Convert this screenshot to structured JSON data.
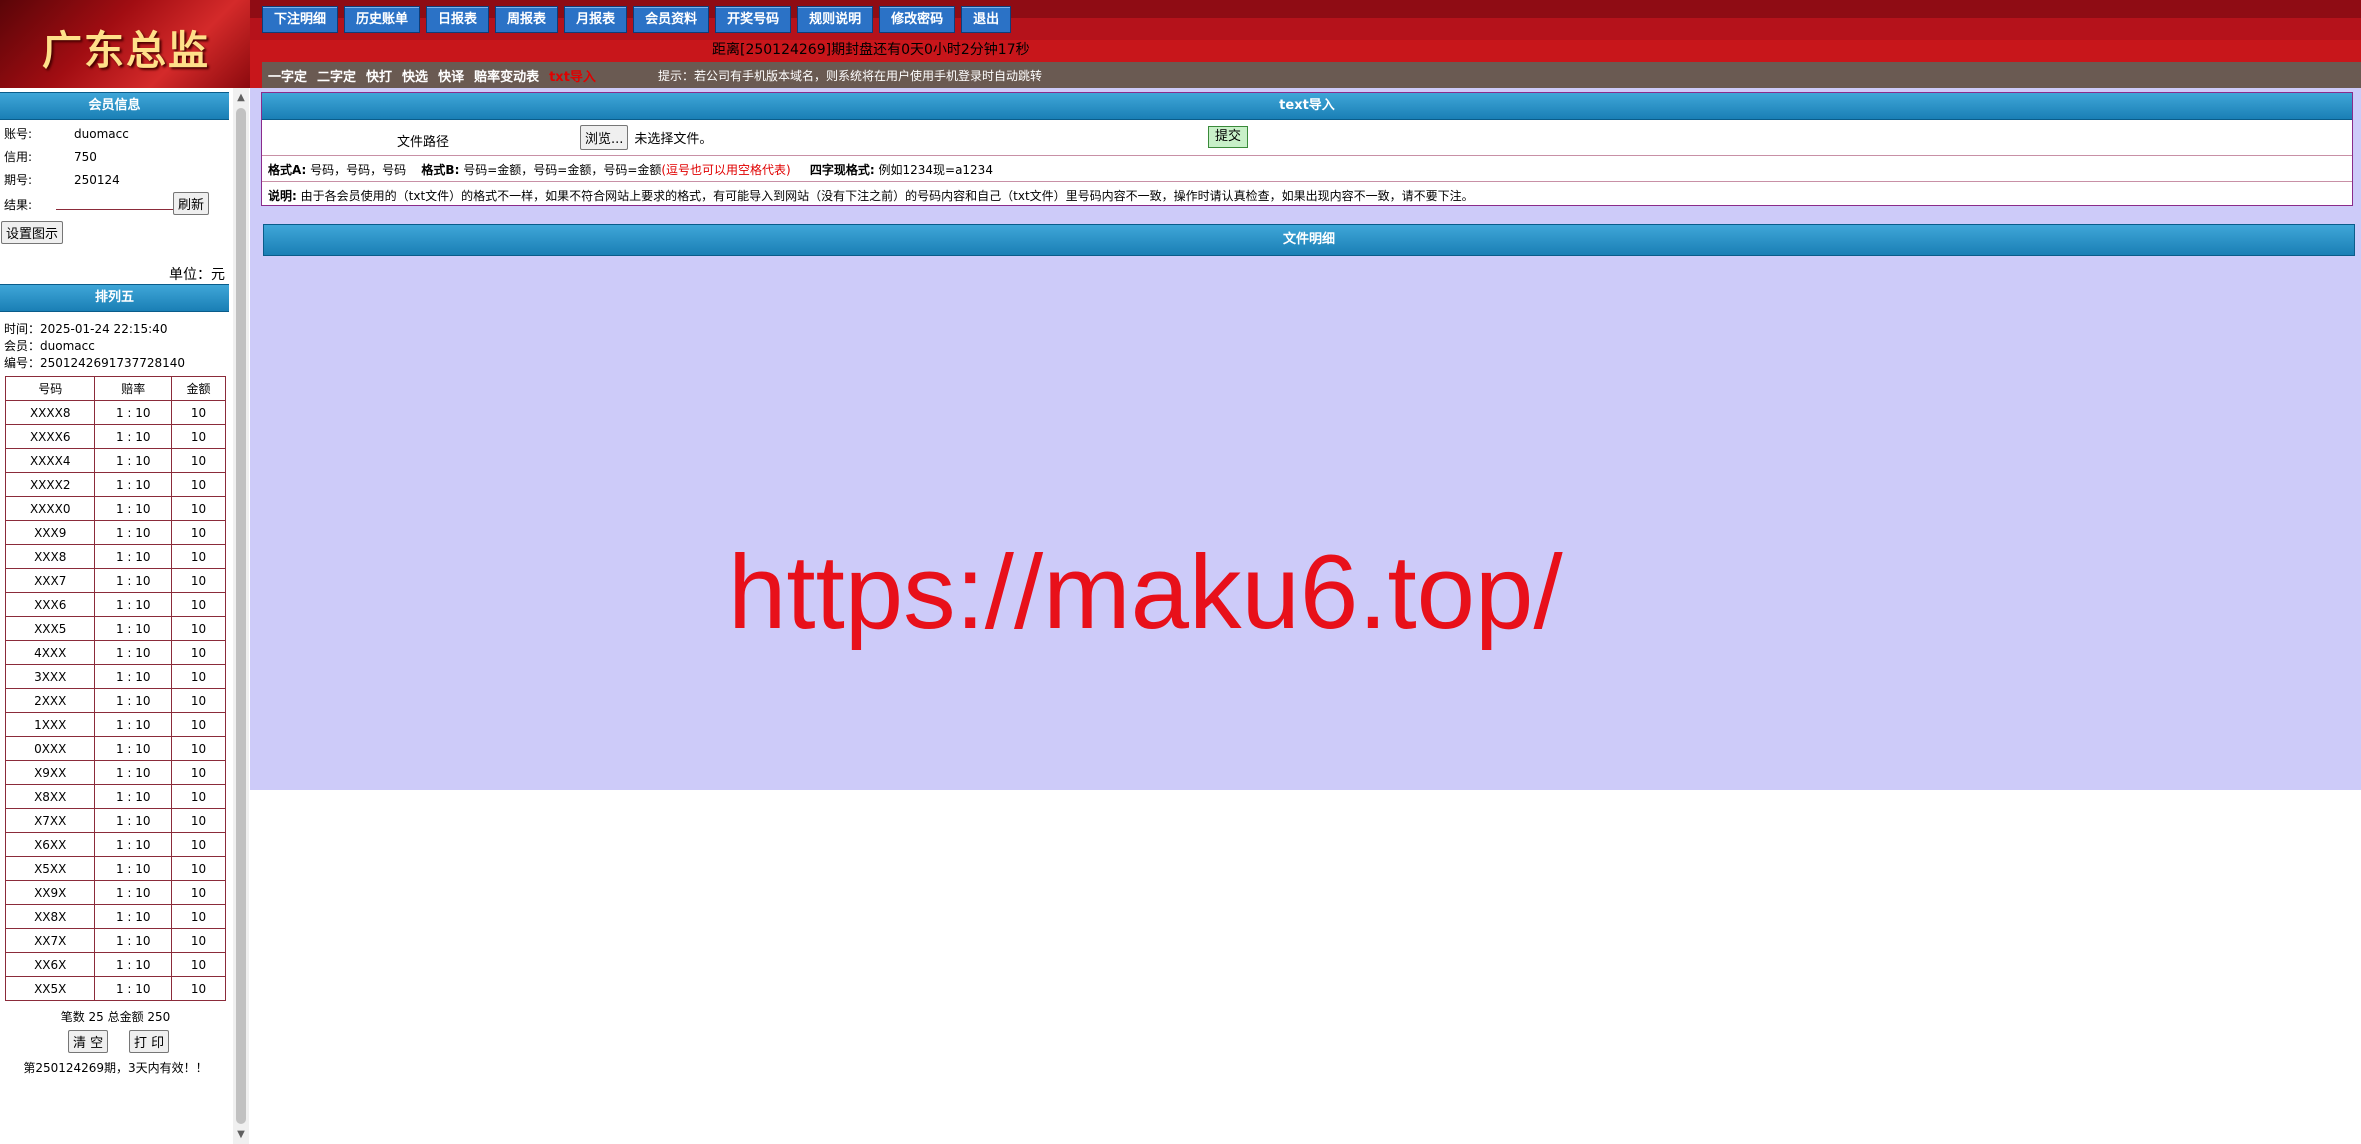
{
  "brand": {
    "logo_text": "广东总监"
  },
  "nav": {
    "buttons": [
      "下注明细",
      "历史账单",
      "日报表",
      "周报表",
      "月报表",
      "会员资料",
      "开奖号码",
      "规则说明",
      "修改密码",
      "退出"
    ],
    "countdown": "距离[250124269]期封盘还有0天0小时2分钟17秒"
  },
  "subnav": {
    "items": [
      "一字定",
      "二字定",
      "快打",
      "快选",
      "快译",
      "赔率变动表",
      "txt导入"
    ],
    "tip": "提示：若公司有手机版本域名，则系统将在用户使用手机登录时自动跳转"
  },
  "member": {
    "title": "会员信息",
    "account_label": "账号:",
    "account": "duomacc",
    "credit_label": "信用:",
    "credit": "750",
    "period_label": "期号:",
    "period": "250124",
    "result_label": "结果:",
    "refresh_label": "刷新",
    "settings_label": "设置图示",
    "unit": "单位：元"
  },
  "ticket": {
    "title": "排列五",
    "time": "时间：2025-01-24 22:15:40",
    "member": "会员：duomacc",
    "serial": "编号：2501242691737728140",
    "columns": [
      "号码",
      "赔率",
      "金额"
    ],
    "rows": [
      [
        "XXXX8",
        "1 : 10",
        "10"
      ],
      [
        "XXXX6",
        "1 : 10",
        "10"
      ],
      [
        "XXXX4",
        "1 : 10",
        "10"
      ],
      [
        "XXXX2",
        "1 : 10",
        "10"
      ],
      [
        "XXXX0",
        "1 : 10",
        "10"
      ],
      [
        "XXX9",
        "1 : 10",
        "10"
      ],
      [
        "XXX8",
        "1 : 10",
        "10"
      ],
      [
        "XXX7",
        "1 : 10",
        "10"
      ],
      [
        "XXX6",
        "1 : 10",
        "10"
      ],
      [
        "XXX5",
        "1 : 10",
        "10"
      ],
      [
        "4XXX",
        "1 : 10",
        "10"
      ],
      [
        "3XXX",
        "1 : 10",
        "10"
      ],
      [
        "2XXX",
        "1 : 10",
        "10"
      ],
      [
        "1XXX",
        "1 : 10",
        "10"
      ],
      [
        "0XXX",
        "1 : 10",
        "10"
      ],
      [
        "X9XX",
        "1 : 10",
        "10"
      ],
      [
        "X8XX",
        "1 : 10",
        "10"
      ],
      [
        "X7XX",
        "1 : 10",
        "10"
      ],
      [
        "X6XX",
        "1 : 10",
        "10"
      ],
      [
        "X5XX",
        "1 : 10",
        "10"
      ],
      [
        "XX9X",
        "1 : 10",
        "10"
      ],
      [
        "XX8X",
        "1 : 10",
        "10"
      ],
      [
        "XX7X",
        "1 : 10",
        "10"
      ],
      [
        "XX6X",
        "1 : 10",
        "10"
      ],
      [
        "XX5X",
        "1 : 10",
        "10"
      ]
    ],
    "summary": "笔数 25 总金额 250",
    "clear_label": "清 空",
    "print_label": "打 印",
    "validity": "第250124269期，3天内有效！！"
  },
  "import": {
    "title": "text导入",
    "file_label": "文件路径",
    "browse_label": "浏览...",
    "no_file": "未选择文件。",
    "submit_label": "提交",
    "format_a_label": "格式A:",
    "format_a": "号码，号码，号码",
    "format_b_label": "格式B:",
    "format_b": "号码=金额，号码=金额，号码=金额",
    "format_b_note": "(逗号也可以用空格代表)",
    "four_digit_label": "四字现格式:",
    "four_digit": "例如1234现=a1234",
    "note_label": "说明:",
    "note": "由于各会员使用的（txt文件）的格式不一样，如果不符合网站上要求的格式，有可能导入到网站（没有下注之前）的号码内容和自己（txt文件）里号码内容不一致，操作时请认真检查，如果出现内容不一致，请不要下注。"
  },
  "detail": {
    "title": "文件明细"
  },
  "watermark": "https://maku6.top/",
  "colors": {
    "header_red": "#c8161b",
    "panel_blue": "#1a7fb5",
    "main_bg": "#cdcbf9",
    "watermark": "#e8101a"
  }
}
